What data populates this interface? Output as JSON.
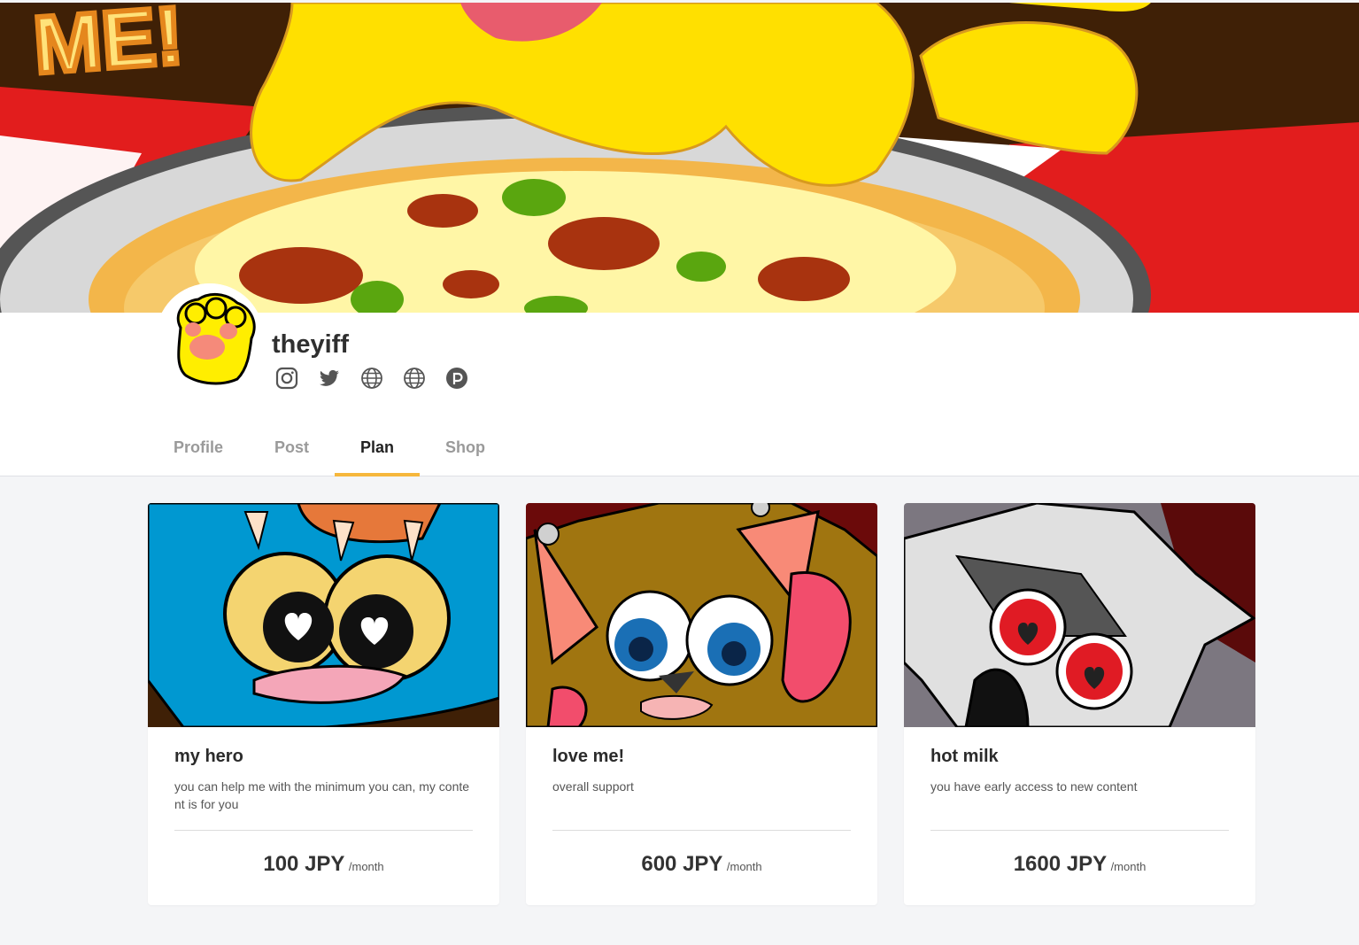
{
  "profile": {
    "username": "theyiff",
    "socials": [
      {
        "icon": "instagram-icon"
      },
      {
        "icon": "twitter-icon"
      },
      {
        "icon": "globe-icon"
      },
      {
        "icon": "globe-icon"
      },
      {
        "icon": "pixiv-icon"
      }
    ]
  },
  "banner": {
    "text": "ME!"
  },
  "tabs": [
    {
      "label": "Profile",
      "active": false
    },
    {
      "label": "Post",
      "active": false
    },
    {
      "label": "Plan",
      "active": true
    },
    {
      "label": "Shop",
      "active": false
    }
  ],
  "plans": [
    {
      "title": "my hero",
      "description": "you can help me with the minimum you can, my content is for you",
      "price": "100 JPY",
      "period": "/month"
    },
    {
      "title": "love me!",
      "description": "overall support",
      "price": "600 JPY",
      "period": "/month"
    },
    {
      "title": "hot milk",
      "description": "you have early access to new content",
      "price": "1600 JPY",
      "period": "/month"
    }
  ],
  "colors": {
    "tab_active_underline": "#f6b73c",
    "background": "#f4f5f7"
  }
}
